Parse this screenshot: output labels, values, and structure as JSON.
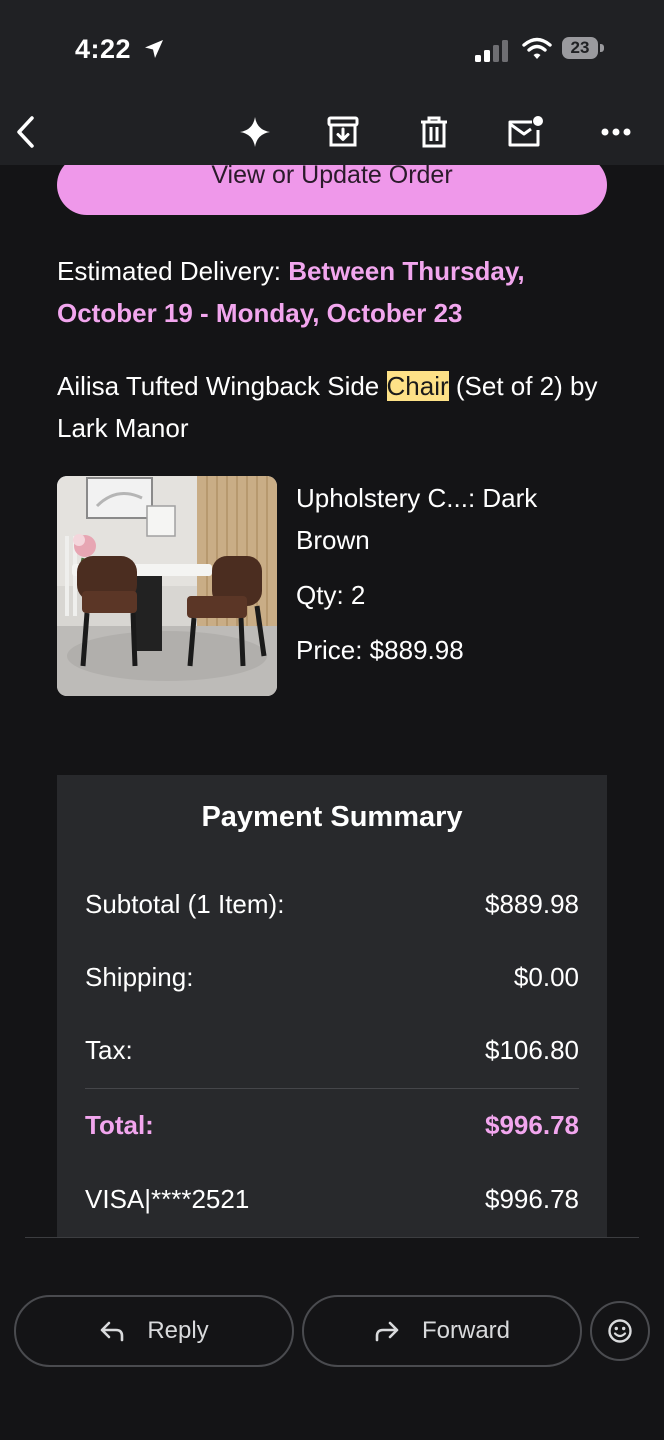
{
  "status_bar": {
    "time": "4:22",
    "battery": "23"
  },
  "toolbar": {
    "icons": [
      "back-icon",
      "sparkle-icon",
      "archive-icon",
      "trash-icon",
      "mark-unread-icon",
      "more-icon"
    ]
  },
  "email": {
    "order_button": "View or Update Order",
    "delivery_label": "Estimated Delivery: ",
    "delivery_value": "Between Thursday, October 19 - Monday, October 23",
    "product_before": "Ailisa Tufted Wingback Side ",
    "product_highlight": "Chair",
    "product_after": " (Set of 2) by Lark Manor",
    "upholstery": "Upholstery C...: Dark Brown",
    "qty": "Qty: 2",
    "price": "Price: $889.98"
  },
  "payment": {
    "title": "Payment Summary",
    "rows": [
      {
        "label": "Subtotal (1 Item):",
        "value": "$889.98"
      },
      {
        "label": "Shipping:",
        "value": "$0.00"
      },
      {
        "label": "Tax:",
        "value": "$106.80"
      },
      {
        "label": "Total:",
        "value": "$996.78"
      },
      {
        "label": "VISA|****2521",
        "value": "$996.78"
      }
    ]
  },
  "actions": {
    "reply": "Reply",
    "forward": "Forward"
  },
  "colors": {
    "accent": "#ef98ea",
    "accent_text": "#f2a6ee",
    "highlight": "#fde187",
    "background": "#141416",
    "bar": "#202124",
    "card": "#28292c"
  }
}
